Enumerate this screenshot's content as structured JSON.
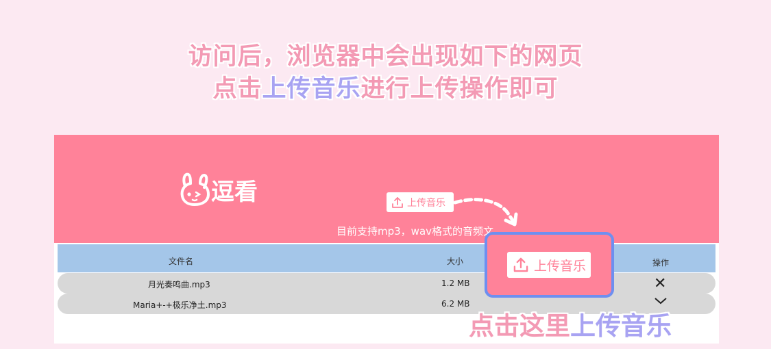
{
  "headline": {
    "line1": "访问后，浏览器中会出现如下的网页",
    "line2_prefix": "点击",
    "line2_highlight": "上传音乐",
    "line2_suffix": "进行上传操作即可"
  },
  "app": {
    "logo_text": "逗看",
    "upload_button_label": "上传音乐",
    "support_text": "目前支持mp3，wav格式的音频文"
  },
  "table": {
    "columns": [
      "文件名",
      "大小",
      "操作"
    ],
    "rows": [
      {
        "name": "月光奏鸣曲.mp3",
        "size": "1.2 MB"
      },
      {
        "name": "Maria+-+极乐净土.mp3",
        "size": "6.2 MB"
      }
    ]
  },
  "callout": {
    "upload_button_label": "上传音乐",
    "caption_prefix": "点击这里",
    "caption_highlight": "上传音乐"
  },
  "icons": [
    "upload-icon",
    "close-icon",
    "chevron-down-icon",
    "bunny-logo-icon"
  ],
  "colors": {
    "accent_pink": "#ff8299",
    "header_blue": "#a4c6e9",
    "lavender": "#a8a3f2",
    "headline_pink": "#f39ab4",
    "callout_blue": "#6e8ff0"
  }
}
